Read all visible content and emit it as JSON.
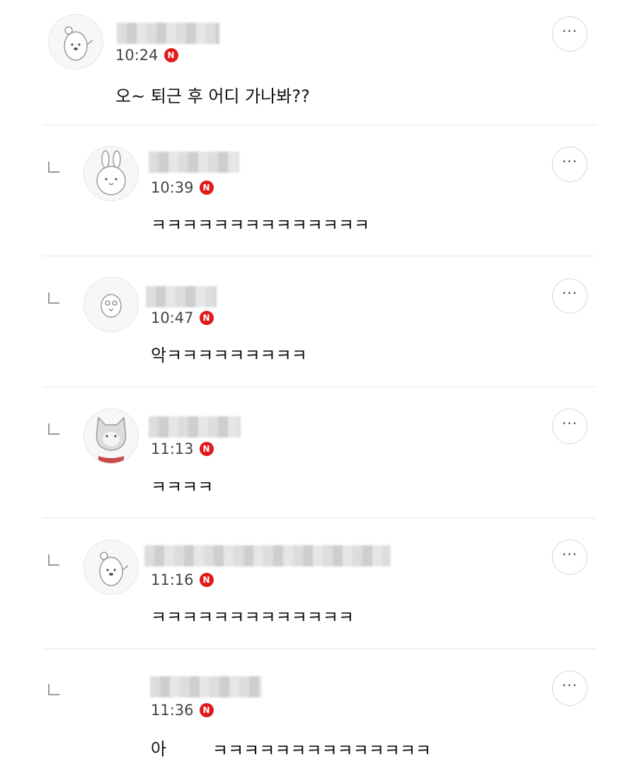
{
  "comments": [
    {
      "time": "10:24",
      "badge": "N",
      "text": "오~ 퇴근 후 어디 가나봐??",
      "more": "···",
      "avatar": "bear-avatar"
    },
    {
      "time": "10:39",
      "badge": "N",
      "text": "ㅋㅋㅋㅋㅋㅋㅋㅋㅋㅋㅋㅋㅋㅋ",
      "more": "···",
      "avatar": "rabbit-avatar"
    },
    {
      "time": "10:47",
      "badge": "N",
      "text": "악ㅋㅋㅋㅋㅋㅋㅋㅋㅋ",
      "more": "···",
      "avatar": "chick-avatar"
    },
    {
      "time": "11:13",
      "badge": "N",
      "text": "ㅋㅋㅋㅋ",
      "more": "···",
      "avatar": "cat-avatar"
    },
    {
      "time": "11:16",
      "badge": "N",
      "text": "ㅋㅋㅋㅋㅋㅋㅋㅋㅋㅋㅋㅋㅋ",
      "more": "···",
      "avatar": "bear-avatar"
    },
    {
      "time": "11:36",
      "badge": "N",
      "text_a": "아",
      "text_b": "ㅋㅋㅋㅋㅋㅋㅋㅋㅋㅋㅋㅋㅋㅋ",
      "more": "···"
    }
  ],
  "colors": {
    "badge": "#e01a1a",
    "divider": "#e6e6e6"
  }
}
